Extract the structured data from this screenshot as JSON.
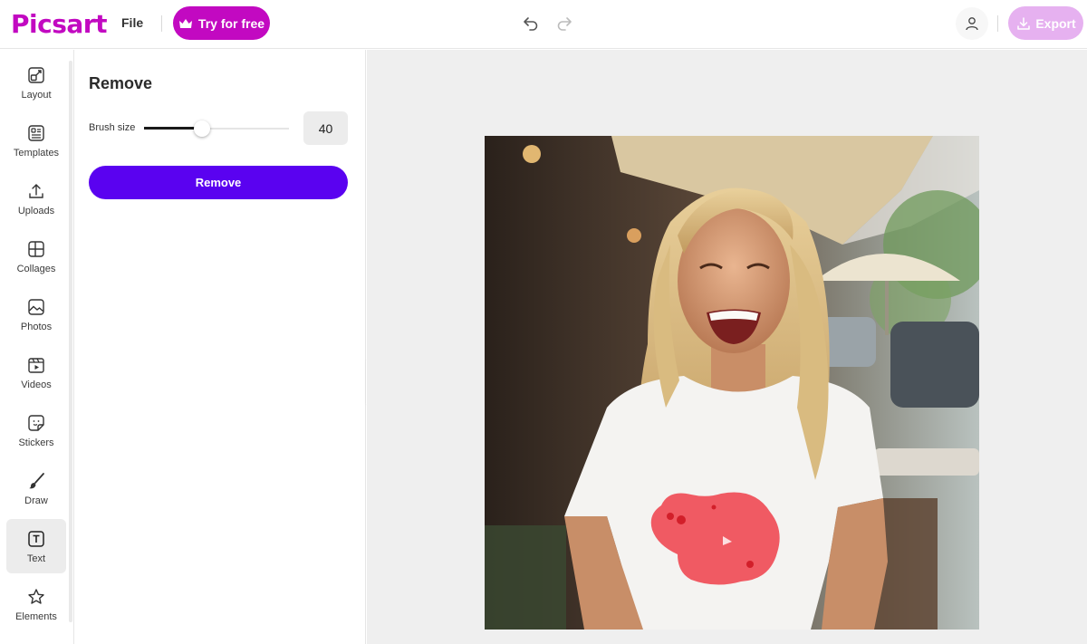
{
  "app": {
    "logo_text": "Picsart",
    "brand_color": "#c209c1",
    "accent_color": "#5a02f0"
  },
  "topbar": {
    "file_label": "File",
    "try_label": "Try for free",
    "export_label": "Export",
    "icons": [
      "crown-icon",
      "undo-icon",
      "redo-icon",
      "user-icon",
      "download-icon"
    ]
  },
  "rail": {
    "items": [
      {
        "label": "Layout",
        "icon": "layout-icon"
      },
      {
        "label": "Templates",
        "icon": "templates-icon"
      },
      {
        "label": "Uploads",
        "icon": "upload-icon"
      },
      {
        "label": "Collages",
        "icon": "collage-icon"
      },
      {
        "label": "Photos",
        "icon": "photo-icon"
      },
      {
        "label": "Videos",
        "icon": "video-icon"
      },
      {
        "label": "Stickers",
        "icon": "sticker-icon"
      },
      {
        "label": "Draw",
        "icon": "brush-icon"
      },
      {
        "label": "Text",
        "icon": "text-icon",
        "active": true
      },
      {
        "label": "Elements",
        "icon": "star-icon"
      }
    ]
  },
  "panel": {
    "title": "Remove",
    "brush_label": "Brush size",
    "brush_value": "40",
    "brush_fraction": 0.4,
    "remove_button": "Remove"
  },
  "canvas": {
    "photo_description_icon": "photo-canvas",
    "mask_color": "#f05a63"
  }
}
